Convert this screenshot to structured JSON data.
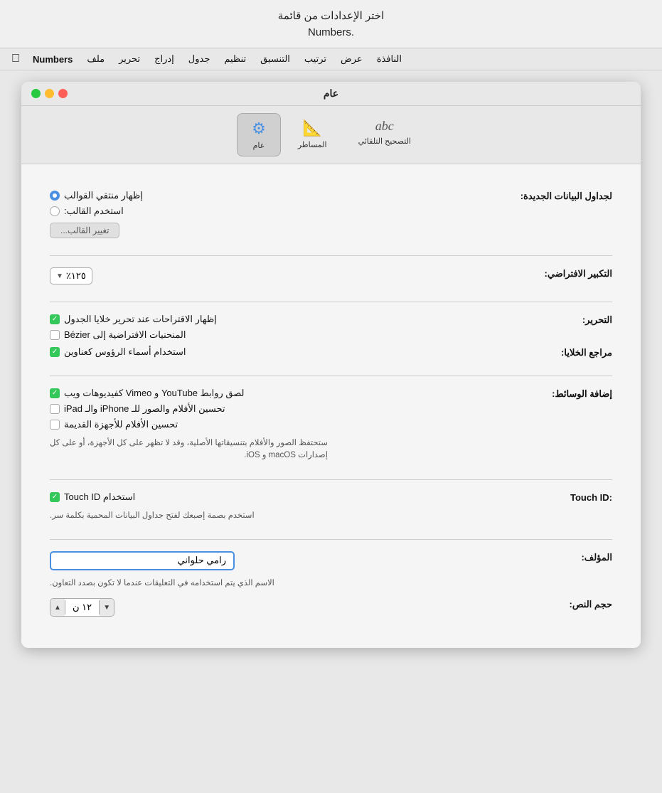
{
  "tooltip": {
    "line1": "اختر الإعدادات من قائمة",
    "line2": ".Numbers"
  },
  "menubar": {
    "items": [
      {
        "label": "Numbers",
        "bold": true
      },
      {
        "label": "ملف"
      },
      {
        "label": "تحرير"
      },
      {
        "label": "إدراج"
      },
      {
        "label": "جدول"
      },
      {
        "label": "تنظيم"
      },
      {
        "label": "التنسيق"
      },
      {
        "label": "ترتيب"
      },
      {
        "label": "عرض"
      },
      {
        "label": "النافذة"
      }
    ]
  },
  "window": {
    "title": "عام",
    "controls": {
      "close": "●",
      "minimize": "●",
      "maximize": "●"
    }
  },
  "toolbar": {
    "buttons": [
      {
        "id": "general",
        "label": "عام",
        "icon": "⚙",
        "active": true
      },
      {
        "id": "rulers",
        "label": "المساطر",
        "icon": "📏",
        "active": false
      },
      {
        "id": "autocorrect",
        "label": "التصحيح التلقائي",
        "icon": "abc",
        "active": false
      }
    ]
  },
  "sections": {
    "new_data_tables": {
      "label": "لجداول البيانات الجديدة:",
      "options": [
        {
          "id": "show_template_chooser",
          "label": "إظهار منتقي القوالب",
          "checked": true,
          "type": "radio"
        },
        {
          "id": "use_template",
          "label": "استخدم القالب:",
          "checked": false,
          "type": "radio"
        }
      ],
      "button": "تغيير القالب..."
    },
    "default_zoom": {
      "label": "التكبير الافتراضي:",
      "value": "٪١٢٥"
    },
    "editing": {
      "label": "التحرير:",
      "options": [
        {
          "id": "show_suggestions",
          "label": "إظهار الاقتراحات عند تحرير خلايا الجدول",
          "checked": true
        },
        {
          "id": "bezier",
          "label": "المنحنيات الافتراضية إلى Bézier",
          "checked": false
        }
      ]
    },
    "cell_references": {
      "label": "مراجع الخلايا:",
      "options": [
        {
          "id": "use_header_names",
          "label": "استخدام أسماء الرؤوس كعناوين",
          "checked": true
        }
      ]
    },
    "add_media": {
      "label": "إضافة الوسائط:",
      "options": [
        {
          "id": "paste_youtube",
          "label": "لصق روابط YouTube و Vimeo كفيديوهات ويب",
          "checked": true
        },
        {
          "id": "optimize_iphone_ipad",
          "label": "تحسين الأفلام والصور للـ iPhone والـ iPad",
          "checked": false
        },
        {
          "id": "optimize_old",
          "label": "تحسين الأفلام للأجهزة القديمة",
          "checked": false
        }
      ],
      "helper": "ستحتفظ الصور والأفلام بتنسيقاتها الأصلية، وقد لا تظهر على كل الأجهزة، أو على كل\nإصدارات macOS و iOS."
    },
    "touch_id": {
      "label": ":Touch ID",
      "options": [
        {
          "id": "use_touch_id",
          "label": "استخدام Touch ID",
          "checked": true
        }
      ],
      "helper": "استخدم بصمة إصبعك لفتح جداول البيانات المحمية بكلمة سر."
    },
    "author": {
      "label": "المؤلف:",
      "value": "رامي حلواني",
      "helper": "الاسم الذي يتم استخدامه في التعليقات عندما لا تكون بصدد التعاون."
    },
    "font_size": {
      "label": "حجم النص:",
      "value": "١٢",
      "unit": "ن"
    }
  }
}
